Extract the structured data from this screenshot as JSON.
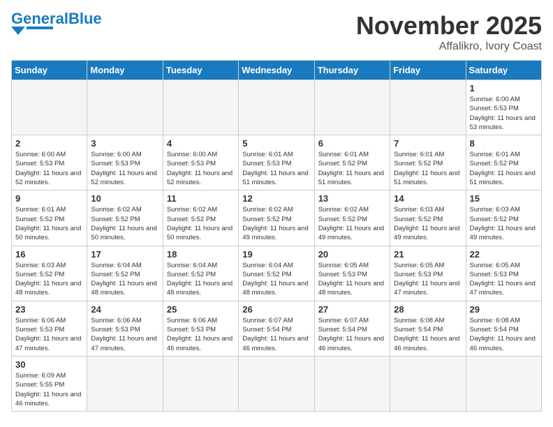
{
  "header": {
    "logo_general": "General",
    "logo_blue": "Blue",
    "month_year": "November 2025",
    "location": "Affalikro, Ivory Coast"
  },
  "days_of_week": [
    "Sunday",
    "Monday",
    "Tuesday",
    "Wednesday",
    "Thursday",
    "Friday",
    "Saturday"
  ],
  "weeks": [
    [
      {
        "day": "",
        "info": ""
      },
      {
        "day": "",
        "info": ""
      },
      {
        "day": "",
        "info": ""
      },
      {
        "day": "",
        "info": ""
      },
      {
        "day": "",
        "info": ""
      },
      {
        "day": "",
        "info": ""
      },
      {
        "day": "1",
        "info": "Sunrise: 6:00 AM\nSunset: 5:53 PM\nDaylight: 11 hours and 53 minutes."
      }
    ],
    [
      {
        "day": "2",
        "info": "Sunrise: 6:00 AM\nSunset: 5:53 PM\nDaylight: 11 hours and 52 minutes."
      },
      {
        "day": "3",
        "info": "Sunrise: 6:00 AM\nSunset: 5:53 PM\nDaylight: 11 hours and 52 minutes."
      },
      {
        "day": "4",
        "info": "Sunrise: 6:00 AM\nSunset: 5:53 PM\nDaylight: 11 hours and 52 minutes."
      },
      {
        "day": "5",
        "info": "Sunrise: 6:01 AM\nSunset: 5:53 PM\nDaylight: 11 hours and 51 minutes."
      },
      {
        "day": "6",
        "info": "Sunrise: 6:01 AM\nSunset: 5:52 PM\nDaylight: 11 hours and 51 minutes."
      },
      {
        "day": "7",
        "info": "Sunrise: 6:01 AM\nSunset: 5:52 PM\nDaylight: 11 hours and 51 minutes."
      },
      {
        "day": "8",
        "info": "Sunrise: 6:01 AM\nSunset: 5:52 PM\nDaylight: 11 hours and 51 minutes."
      }
    ],
    [
      {
        "day": "9",
        "info": "Sunrise: 6:01 AM\nSunset: 5:52 PM\nDaylight: 11 hours and 50 minutes."
      },
      {
        "day": "10",
        "info": "Sunrise: 6:02 AM\nSunset: 5:52 PM\nDaylight: 11 hours and 50 minutes."
      },
      {
        "day": "11",
        "info": "Sunrise: 6:02 AM\nSunset: 5:52 PM\nDaylight: 11 hours and 50 minutes."
      },
      {
        "day": "12",
        "info": "Sunrise: 6:02 AM\nSunset: 5:52 PM\nDaylight: 11 hours and 49 minutes."
      },
      {
        "day": "13",
        "info": "Sunrise: 6:02 AM\nSunset: 5:52 PM\nDaylight: 11 hours and 49 minutes."
      },
      {
        "day": "14",
        "info": "Sunrise: 6:03 AM\nSunset: 5:52 PM\nDaylight: 11 hours and 49 minutes."
      },
      {
        "day": "15",
        "info": "Sunrise: 6:03 AM\nSunset: 5:52 PM\nDaylight: 11 hours and 49 minutes."
      }
    ],
    [
      {
        "day": "16",
        "info": "Sunrise: 6:03 AM\nSunset: 5:52 PM\nDaylight: 11 hours and 48 minutes."
      },
      {
        "day": "17",
        "info": "Sunrise: 6:04 AM\nSunset: 5:52 PM\nDaylight: 11 hours and 48 minutes."
      },
      {
        "day": "18",
        "info": "Sunrise: 6:04 AM\nSunset: 5:52 PM\nDaylight: 11 hours and 48 minutes."
      },
      {
        "day": "19",
        "info": "Sunrise: 6:04 AM\nSunset: 5:52 PM\nDaylight: 11 hours and 48 minutes."
      },
      {
        "day": "20",
        "info": "Sunrise: 6:05 AM\nSunset: 5:53 PM\nDaylight: 11 hours and 48 minutes."
      },
      {
        "day": "21",
        "info": "Sunrise: 6:05 AM\nSunset: 5:53 PM\nDaylight: 11 hours and 47 minutes."
      },
      {
        "day": "22",
        "info": "Sunrise: 6:05 AM\nSunset: 5:53 PM\nDaylight: 11 hours and 47 minutes."
      }
    ],
    [
      {
        "day": "23",
        "info": "Sunrise: 6:06 AM\nSunset: 5:53 PM\nDaylight: 11 hours and 47 minutes."
      },
      {
        "day": "24",
        "info": "Sunrise: 6:06 AM\nSunset: 5:53 PM\nDaylight: 11 hours and 47 minutes."
      },
      {
        "day": "25",
        "info": "Sunrise: 6:06 AM\nSunset: 5:53 PM\nDaylight: 11 hours and 46 minutes."
      },
      {
        "day": "26",
        "info": "Sunrise: 6:07 AM\nSunset: 5:54 PM\nDaylight: 11 hours and 46 minutes."
      },
      {
        "day": "27",
        "info": "Sunrise: 6:07 AM\nSunset: 5:54 PM\nDaylight: 11 hours and 46 minutes."
      },
      {
        "day": "28",
        "info": "Sunrise: 6:08 AM\nSunset: 5:54 PM\nDaylight: 11 hours and 46 minutes."
      },
      {
        "day": "29",
        "info": "Sunrise: 6:08 AM\nSunset: 5:54 PM\nDaylight: 11 hours and 46 minutes."
      }
    ],
    [
      {
        "day": "30",
        "info": "Sunrise: 6:09 AM\nSunset: 5:55 PM\nDaylight: 11 hours and 46 minutes."
      },
      {
        "day": "",
        "info": ""
      },
      {
        "day": "",
        "info": ""
      },
      {
        "day": "",
        "info": ""
      },
      {
        "day": "",
        "info": ""
      },
      {
        "day": "",
        "info": ""
      },
      {
        "day": "",
        "info": ""
      }
    ]
  ]
}
